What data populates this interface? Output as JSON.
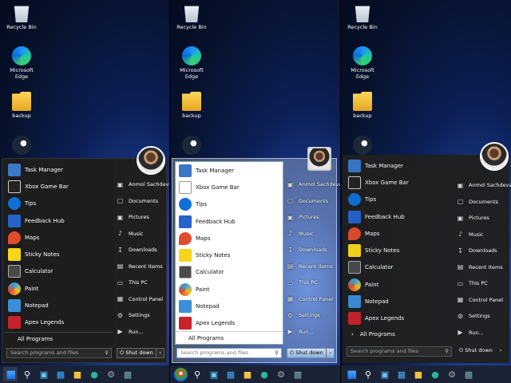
{
  "desktop": {
    "icons": [
      "Recycle Bin",
      "Microsoft Edge",
      "backup",
      ""
    ]
  },
  "menu": {
    "programs": [
      "Task Manager",
      "Xbox Game Bar",
      "Tips",
      "Feedback Hub",
      "Maps",
      "Sticky Notes",
      "Calculator",
      "Paint",
      "Notepad",
      "Apex Legends"
    ],
    "all_programs": "All Programs",
    "search_placeholder": "Search programs and files",
    "user": "Anmol Sachdeva",
    "places": [
      "Documents",
      "Pictures",
      "Music",
      "Downloads",
      "Recent Items",
      "This PC",
      "Control Panel",
      "Settings",
      "Run..."
    ],
    "shutdown": "Shut down"
  },
  "colors": {
    "tips": "#0e6fd8",
    "maps": "#e04b2b",
    "sticky": "#f7d51a",
    "paint": "#2aa4e8",
    "apex": "#c8232c",
    "calc": "#4a4a4a"
  }
}
